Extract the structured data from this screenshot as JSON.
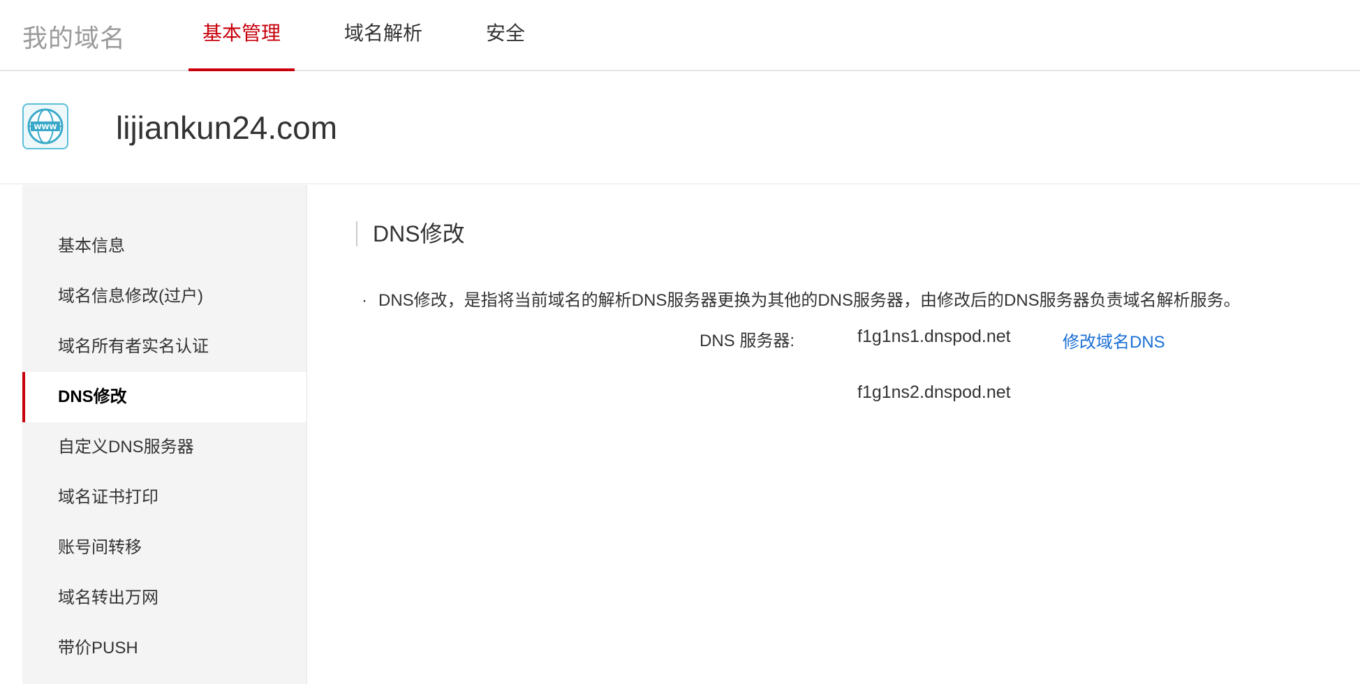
{
  "header": {
    "brand": "我的域名",
    "tabs": [
      {
        "label": "基本管理",
        "active": true
      },
      {
        "label": "域名解析",
        "active": false
      },
      {
        "label": "安全",
        "active": false
      }
    ],
    "accent_color": "#c7000b"
  },
  "domain": {
    "icon": "www-globe-icon",
    "name": "lijiankun24.com"
  },
  "sidebar": {
    "items": [
      {
        "label": "基本信息"
      },
      {
        "label": "域名信息修改(过户)"
      },
      {
        "label": "域名所有者实名认证"
      },
      {
        "label": "DNS修改",
        "active": true
      },
      {
        "label": "自定义DNS服务器"
      },
      {
        "label": "域名证书打印"
      },
      {
        "label": "账号间转移"
      },
      {
        "label": "域名转出万网"
      },
      {
        "label": "带价PUSH"
      }
    ]
  },
  "main": {
    "title": "DNS修改",
    "bullet": "·",
    "description": "DNS修改，是指将当前域名的解析DNS服务器更换为其他的DNS服务器，由修改后的DNS服务器负责域名解析服务。",
    "dns_label": "DNS 服务器:",
    "dns_servers": [
      "f1g1ns1.dnspod.net",
      "f1g1ns2.dnspod.net"
    ],
    "modify_link": "修改域名DNS",
    "link_color": "#1a6fd6"
  }
}
